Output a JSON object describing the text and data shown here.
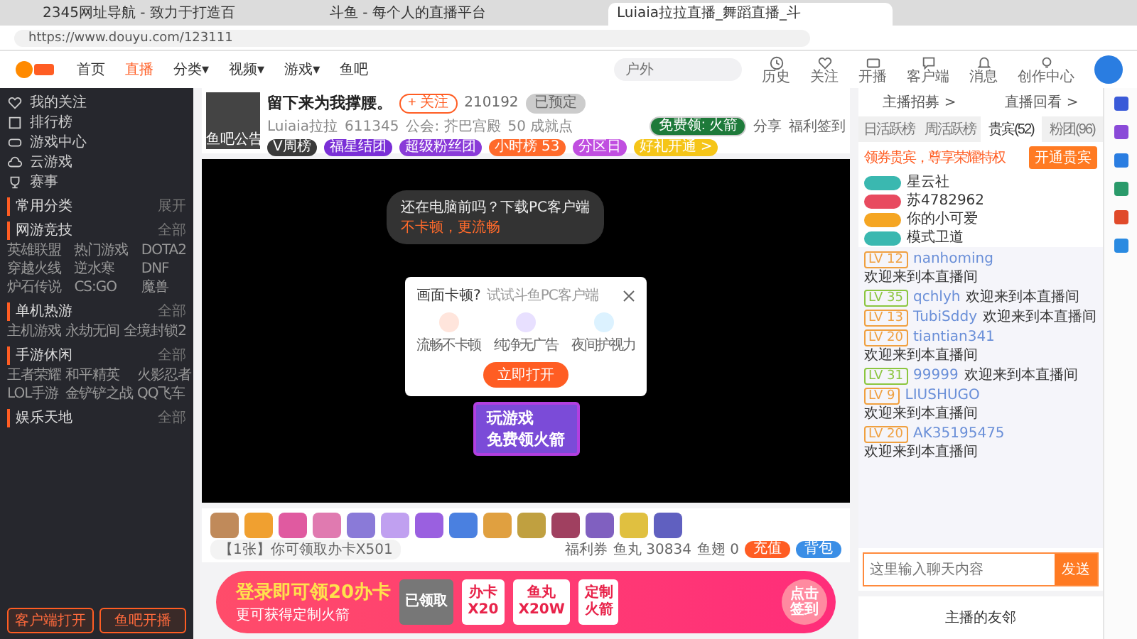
{
  "browser": {
    "tabs": [
      {
        "title": "2345网址导航 - 致力于打造百",
        "selected": false
      },
      {
        "title": "斗鱼 - 每个人的直播平台",
        "selected": false
      },
      {
        "title": "Luiaia拉拉直播_舞蹈直播_斗",
        "selected": true
      }
    ],
    "url": "https://www.douyu.com/123111"
  },
  "nav": {
    "items": [
      {
        "label": "首页",
        "selected": false
      },
      {
        "label": "直播",
        "selected": true
      },
      {
        "label": "分类▾",
        "selected": false
      },
      {
        "label": "视频▾",
        "selected": false
      },
      {
        "label": "游戏▾",
        "selected": false
      },
      {
        "label": "鱼吧",
        "selected": false
      }
    ],
    "search": {
      "placeholder": "户外"
    },
    "tools": [
      {
        "label": "历史",
        "kind": "clock"
      },
      {
        "label": "关注",
        "kind": "heart"
      },
      {
        "label": "开播",
        "kind": "camera"
      },
      {
        "label": "客户端",
        "kind": "chat"
      },
      {
        "label": "消息",
        "kind": "bell"
      },
      {
        "label": "创作中心",
        "kind": "bulb"
      }
    ]
  },
  "sidebar": {
    "links": [
      {
        "label": "我的关注",
        "kind": "heart"
      },
      {
        "label": "排行榜",
        "kind": "list"
      },
      {
        "label": "游戏中心",
        "kind": "game"
      },
      {
        "label": "云游戏",
        "kind": "cloud"
      },
      {
        "label": "赛事",
        "kind": "trophy"
      }
    ],
    "sections": [
      {
        "title": "常用分类",
        "more": "展开"
      },
      {
        "title": "网游竞技",
        "more": "全部",
        "items": [
          "英雄联盟",
          "热门游戏",
          "DOTA2",
          "穿越火线",
          "逆水寒",
          "DNF",
          "炉石传说",
          "CS:GO",
          "魔兽"
        ]
      },
      {
        "title": "单机热游",
        "more": "全部",
        "items": [
          "主机游戏",
          "永劫无间",
          "全境封锁2"
        ]
      },
      {
        "title": "手游休闲",
        "more": "全部",
        "items": [
          "王者荣耀",
          "和平精英",
          "火影忍者",
          "LOL手游",
          "金铲铲之战",
          "QQ飞车"
        ]
      },
      {
        "title": "娱乐天地",
        "more": "全部"
      }
    ],
    "buttons": [
      "客户端打开",
      "鱼吧开播"
    ]
  },
  "room": {
    "title": "留下来为我撑腰。",
    "anchor": "Luiaia拉拉",
    "hot": "611345",
    "guild": "公会: 芥巴宫殿",
    "score": "50 成就点",
    "avatar_labels": [
      "鱼吧",
      "公告"
    ],
    "badges": [
      {
        "label": "V周榜",
        "color": "#3a3a3a"
      },
      {
        "label": "福星结团",
        "color": "#7a2fd6"
      },
      {
        "label": "超级粉丝团",
        "color": "#8a3bd8"
      },
      {
        "label": "小时榜 53",
        "color": "#ff6a2b"
      },
      {
        "label": "分区日",
        "color": "#c04ee0"
      },
      {
        "label": "好礼开通 >",
        "color": "#f5c518"
      }
    ],
    "follow": "+ 关注",
    "followers": "210192",
    "subscribe": "已预定",
    "free": "免费领: 火箭",
    "share": "分享",
    "report": "福利签到"
  },
  "video": {
    "bubble": [
      "还在电脑前吗？下载PC客户端",
      "不卡顿，更流畅"
    ],
    "dialog": {
      "title": "画面卡顿?",
      "subtitle": "试试斗鱼PC客户端",
      "features": [
        "流畅不卡顿",
        "纯净无广告",
        "夜间护视力"
      ],
      "button": "立即打开"
    },
    "promo": [
      "玩游戏",
      "免费领火箭"
    ]
  },
  "giftbar": {
    "notice": "【1张】你可领取办卡X501",
    "coupon": "福利券",
    "fish": "鱼丸 30834",
    "fin": "鱼翅 0",
    "recharge": "充值",
    "bag": "背包"
  },
  "banner": {
    "headline": "登录即可领20办卡",
    "sub": "更可获得定制火箭",
    "claimed": "已领取",
    "items": [
      {
        "top": "办卡",
        "bottom": "X20"
      },
      {
        "top": "鱼丸",
        "bottom": "X20W"
      },
      {
        "top": "定制",
        "bottom": "火箭"
      }
    ],
    "cta": [
      "点击",
      "签到"
    ]
  },
  "panel": {
    "links": [
      "主播招募 >",
      "直播回看 >"
    ],
    "tabs": [
      {
        "label": "日活跃榜",
        "selected": false
      },
      {
        "label": "周活跃榜",
        "selected": false
      },
      {
        "label": "贵宾(52)",
        "selected": true
      },
      {
        "label": "粉团(96)",
        "selected": false
      }
    ],
    "promo": "领券贵宾，尊享荣耀特权",
    "promo_button": "开通贵宾",
    "vips": [
      {
        "name": "星云社",
        "color": "#3ab8b0"
      },
      {
        "name": "苏4782962",
        "color": "#e84a5f"
      },
      {
        "name": "你的小可爱",
        "color": "#f5a623"
      },
      {
        "name": "模式卫道",
        "color": "#3ab8b0"
      }
    ],
    "chat": [
      {
        "level": "LV 12",
        "color": "#f0a040",
        "user": "nanhoming",
        "text": "欢迎来到本直播间"
      },
      {
        "level": "LV 35",
        "color": "#8cc63f",
        "user": "qchlyh",
        "text": "欢迎来到本直播间"
      },
      {
        "level": "LV 13",
        "color": "#f0a040",
        "user": "TubiSddy",
        "text": "欢迎来到本直播间"
      },
      {
        "level": "LV 20",
        "color": "#f0a040",
        "user": "tiantian341",
        "text": "欢迎来到本直播间"
      },
      {
        "level": "LV 31",
        "color": "#8cc63f",
        "user": "99999",
        "text": "欢迎来到本直播间"
      },
      {
        "level": "LV 9",
        "color": "#f0a040",
        "user": "LIUSHUGO",
        "text": "欢迎来到本直播间"
      },
      {
        "level": "LV 20",
        "color": "#f0a040",
        "user": "AK35195475",
        "text": "欢迎来到本直播间"
      }
    ],
    "input": {
      "placeholder": "这里输入聊天内容"
    },
    "send": "发送",
    "friends": "主播的友邻"
  }
}
